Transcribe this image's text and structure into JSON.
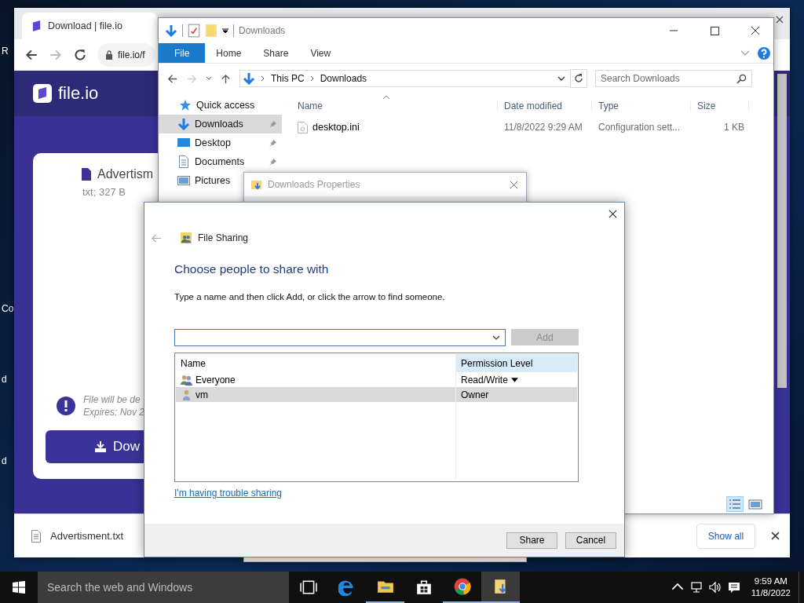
{
  "desktop_labels": [
    "R",
    "Co",
    "d",
    "d"
  ],
  "browser": {
    "tab_title": "Download | file.io",
    "url": "file.io/f",
    "logo": "file.io",
    "file_name": "Advertism",
    "file_meta": "txt; 327 B",
    "notice_lines": [
      "File will be de",
      "Expires: Nov 2"
    ],
    "download_button": "Dow",
    "download_bar": {
      "file": "Advertisment.txt",
      "show_all": "Show all"
    }
  },
  "explorer": {
    "title": "Downloads",
    "ribbon_tabs": [
      {
        "label": "File",
        "selected": true
      },
      {
        "label": "Home",
        "selected": false
      },
      {
        "label": "Share",
        "selected": false
      },
      {
        "label": "View",
        "selected": false
      }
    ],
    "breadcrumb": [
      "This PC",
      "Downloads"
    ],
    "search": {
      "placeholder": "Search Downloads"
    },
    "nav": [
      {
        "label": "Quick access",
        "kind": "star",
        "selected": false,
        "pinned": false
      },
      {
        "label": "Downloads",
        "kind": "downloads",
        "selected": true,
        "pinned": true
      },
      {
        "label": "Desktop",
        "kind": "desktop",
        "selected": false,
        "pinned": true
      },
      {
        "label": "Documents",
        "kind": "documents",
        "selected": false,
        "pinned": true
      },
      {
        "label": "Pictures",
        "kind": "pictures",
        "selected": false,
        "pinned": false
      }
    ],
    "columns": [
      "Name",
      "Date modified",
      "Type",
      "Size"
    ],
    "rows": [
      {
        "name": "desktop.ini",
        "date": "11/8/2022 9:29 AM",
        "type": "Configuration sett...",
        "size": "1 KB"
      }
    ]
  },
  "properties": {
    "title": "Downloads Properties"
  },
  "sharing": {
    "title": "File Sharing",
    "heading": "Choose people to share with",
    "instruction": "Type a name and then click Add, or click the arrow to find someone.",
    "add_button": {
      "label": "Add",
      "disabled": true
    },
    "columns": [
      "Name",
      "Permission Level"
    ],
    "rows": [
      {
        "name": "Everyone",
        "permission": "Read/Write",
        "kind": "group",
        "selected": false
      },
      {
        "name": "vm",
        "permission": "Owner",
        "kind": "user",
        "selected": true
      }
    ],
    "help_link": "I'm having trouble sharing",
    "buttons": [
      "Share",
      "Cancel"
    ]
  },
  "taskbar": {
    "search_placeholder": "Search the web and Windows",
    "apps": [
      {
        "kind": "task-view",
        "running": false,
        "active": false
      },
      {
        "kind": "edge",
        "running": false,
        "active": false
      },
      {
        "kind": "file-explorer",
        "running": true,
        "active": false
      },
      {
        "kind": "store",
        "running": false,
        "active": false
      },
      {
        "kind": "chrome",
        "running": true,
        "active": false
      },
      {
        "kind": "downloads-folder",
        "running": true,
        "active": true
      }
    ],
    "time": "9:59 AM",
    "date": "11/8/2022"
  }
}
